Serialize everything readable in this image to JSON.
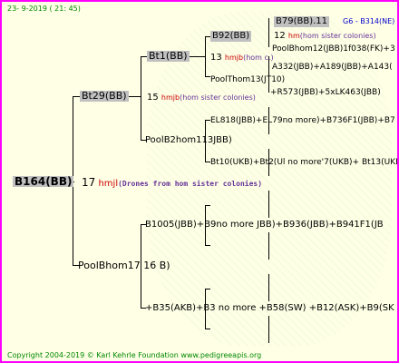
{
  "header": {
    "date": "23-  9-2019  (  21:  45)"
  },
  "root": {
    "name": "B164(BB)"
  },
  "nodes": {
    "bt29": "Bt29(BB)",
    "bt1": "Bt1(BB)",
    "b92": "B92(BB)",
    "b79": "B79(BB).11",
    "g6": "G6 - B314(NE)",
    "n12": "12",
    "n12_txt": "hm",
    "n12_tail": "(hom sister colonies)",
    "poolbhom12": "PoolBhom12(JBB)1f038(FK)+3",
    "n13": "13",
    "n13_txt": "hmjb",
    "n13_tail": "(hom c.)",
    "a332": "A332(JBB)+A189(JBB)+A143(",
    "poolthom13": "PoolThom13(JT10)",
    "r573": "+R573(JBB)+5xLK463(JBB)",
    "n15": "15",
    "n15_txt": "hmjb",
    "n15_tail": "(hom sister colonies)",
    "el818": "EL818(JBB)+EL79no more)+B736F1(JBB)+B7",
    "poolb2": "PoolB2hom113JBB)",
    "bt10": "Bt10(UKB)+Bt2(Ul no more'7(UKB)+ Bt13(UKE",
    "n17": "17",
    "n17_txt": "hmjl",
    "n17_tail": "(Drones from hom sister colonies)",
    "b1005": "B1005(JBB)+B9no more JBB)+B936(JBB)+B941F1(JB",
    "poolbhom17": "PoolBhom17 16 B)",
    "b35": "+B35(AKB)+B3 no more +B58(SW) +B12(ASK)+B9(SK"
  },
  "footer": {
    "text": "Copyright 2004-2019 © Karl Kehrle Foundation    www.pedigreeapis.org"
  }
}
